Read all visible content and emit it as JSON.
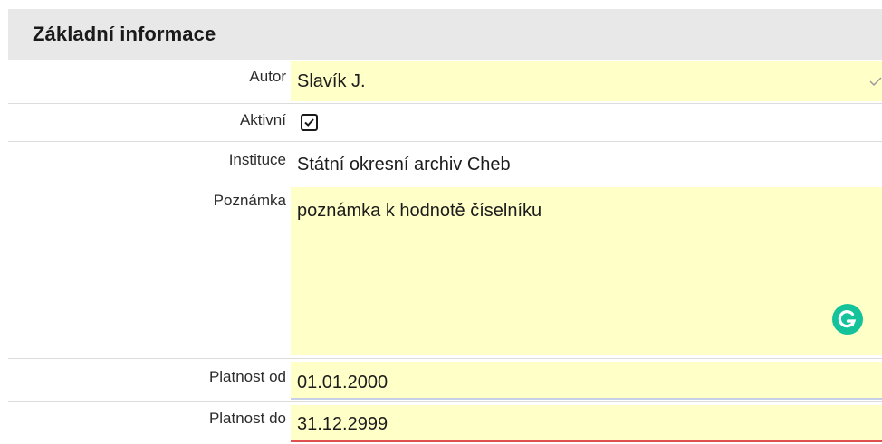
{
  "section": {
    "title": "Základní informace"
  },
  "fields": {
    "autor": {
      "label": "Autor",
      "value": "Slavík J."
    },
    "aktivni": {
      "label": "Aktivní",
      "checked": true
    },
    "instituce": {
      "label": "Instituce",
      "value": "Státní okresní archiv Cheb"
    },
    "poznamka": {
      "label": "Poznámka",
      "value": "poznámka k hodnotě číselníku"
    },
    "platnost_od": {
      "label": "Platnost od",
      "value": "01.01.2000"
    },
    "platnost_do": {
      "label": "Platnost do",
      "value": "31.12.2999"
    }
  },
  "icons": {
    "autor_check": "checkmark-icon",
    "aktivni_checkbox": "checkbox-checked-icon",
    "grammarly": "grammarly-icon"
  },
  "colors": {
    "field_background": "#ffffc8",
    "header_background": "#e8e8e8",
    "grammarly_green": "#15c39a",
    "error_underline": "#e05050"
  }
}
